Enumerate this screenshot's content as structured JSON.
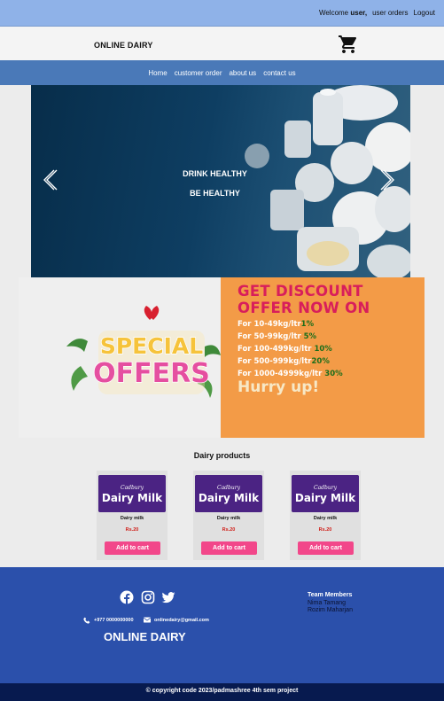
{
  "topbar": {
    "welcome_prefix": "Welcome",
    "user": "user,",
    "user_orders": "user orders",
    "logout": "Logout"
  },
  "header": {
    "brand": "ONLINE DAIRY",
    "cart_icon": "shopping-cart-icon"
  },
  "nav": {
    "items": [
      {
        "label": "Home"
      },
      {
        "label": "customer order"
      },
      {
        "label": "about us"
      },
      {
        "label": "contact us"
      }
    ]
  },
  "hero": {
    "line1": "DRINK HEALTHY",
    "line2": "BE HEALTHY",
    "prev_icon": "chevron-left-icon",
    "next_icon": "chevron-right-icon"
  },
  "offer": {
    "badge": "SPECIAL OFFERS",
    "title_line1": "GET DISCOUNT",
    "title_line2": "OFFER NOW ON",
    "tiers": [
      {
        "range": "For 10-49kg/ltr",
        "pct": "1%"
      },
      {
        "range": "For 50-99kg/ltr",
        "pct": "5%"
      },
      {
        "range": "For 100-499kg/ltr",
        "pct": "10%"
      },
      {
        "range": "For 500-999kg/ltr",
        "pct": "20%"
      },
      {
        "range": "For 1000-4999kg/ltr",
        "pct": "30%"
      }
    ],
    "hurry": "Hurry up!",
    "accent": "#f39b47"
  },
  "products": {
    "title": "Dairy products",
    "items": [
      {
        "image_text": "Dairy Milk",
        "name": "Dairy milk",
        "price": "Rs.20",
        "button": "Add to cart"
      },
      {
        "image_text": "Dairy Milk",
        "name": "Dairy milk",
        "price": "Rs.20",
        "button": "Add to cart"
      },
      {
        "image_text": "Dairy Milk",
        "name": "Dairy milk",
        "price": "Rs.20",
        "button": "Add to cart"
      }
    ]
  },
  "footer": {
    "social": [
      "facebook-icon",
      "instagram-icon",
      "twitter-icon"
    ],
    "phone": "+977 0000000000",
    "email": "onlinedairy@gmail.com",
    "brand": "ONLINE DAIRY",
    "team_title": "Team Members",
    "team": [
      "Nima Tamang",
      "Rozim Maharjan"
    ]
  },
  "copyright": "© copyright code 2023/padmashree 4th sem project",
  "colors": {
    "topbar": "#8fb2e8",
    "nav": "#4a79b8",
    "footer": "#2b50ab",
    "button": "#f2478a"
  }
}
